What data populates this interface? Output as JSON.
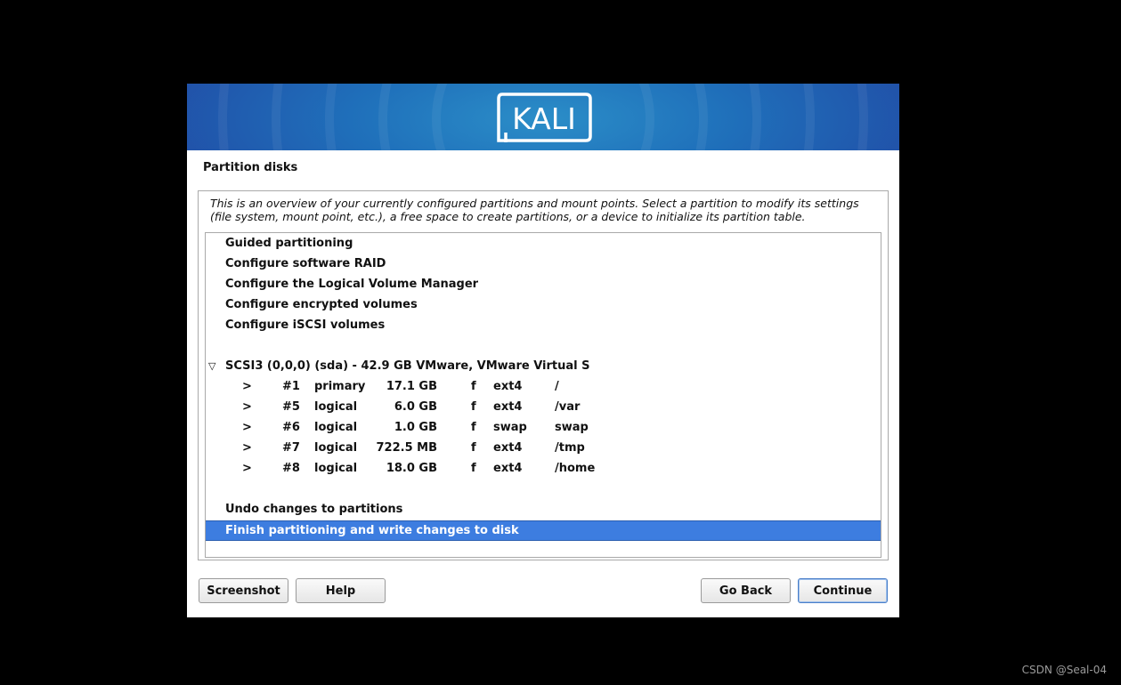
{
  "brand": {
    "logo_text": "KALI"
  },
  "page": {
    "title": "Partition disks",
    "description": "This is an overview of your currently configured partitions and mount points. Select a partition to modify its settings (file system, mount point, etc.), a free space to create partitions, or a device to initialize its partition table."
  },
  "menu": {
    "guided": "Guided partitioning",
    "raid": "Configure software RAID",
    "lvm": "Configure the Logical Volume Manager",
    "encrypted": "Configure encrypted volumes",
    "iscsi": "Configure iSCSI volumes"
  },
  "disk": {
    "expand_glyph": "▽",
    "label": "SCSI3 (0,0,0) (sda) - 42.9 GB VMware, VMware Virtual S",
    "partitions": [
      {
        "arrow": ">",
        "num": "#1",
        "type": "primary",
        "size": "17.1 GB",
        "flag": "f",
        "fs": "ext4",
        "mount": "/"
      },
      {
        "arrow": ">",
        "num": "#5",
        "type": "logical",
        "size": "6.0 GB",
        "flag": "f",
        "fs": "ext4",
        "mount": "/var"
      },
      {
        "arrow": ">",
        "num": "#6",
        "type": "logical",
        "size": "1.0 GB",
        "flag": "f",
        "fs": "swap",
        "mount": "swap"
      },
      {
        "arrow": ">",
        "num": "#7",
        "type": "logical",
        "size": "722.5 MB",
        "flag": "f",
        "fs": "ext4",
        "mount": "/tmp"
      },
      {
        "arrow": ">",
        "num": "#8",
        "type": "logical",
        "size": "18.0 GB",
        "flag": "f",
        "fs": "ext4",
        "mount": "/home"
      }
    ]
  },
  "actions": {
    "undo": "Undo changes to partitions",
    "finish": "Finish partitioning and write changes to disk"
  },
  "buttons": {
    "screenshot": "Screenshot",
    "help": "Help",
    "go_back": "Go Back",
    "continue": "Continue"
  },
  "watermark": "CSDN @Seal-04",
  "colors": {
    "selection": "#3d7de0",
    "banner": "#2150a8"
  }
}
